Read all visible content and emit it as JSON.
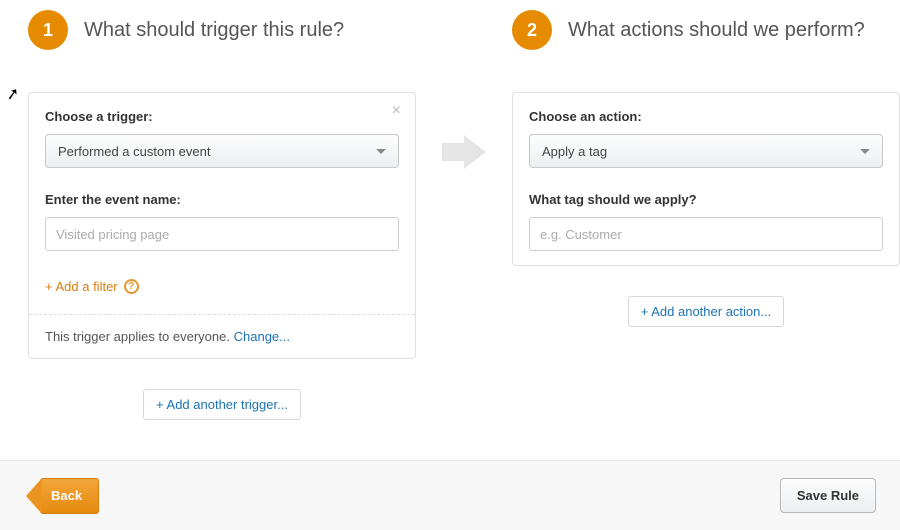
{
  "step1": {
    "number": "1",
    "title": "What should trigger this rule?",
    "card": {
      "trigger_label": "Choose a trigger:",
      "trigger_selected": "Performed a custom event",
      "event_name_label": "Enter the event name:",
      "event_name_placeholder": "Visited pricing page",
      "event_name_value": "",
      "add_filter_text": "+ Add a filter",
      "applies_text": "This trigger applies to everyone. ",
      "change_link": "Change..."
    },
    "add_another": "+ Add another trigger..."
  },
  "step2": {
    "number": "2",
    "title": "What actions should we perform?",
    "card": {
      "action_label": "Choose an action:",
      "action_selected": "Apply a tag",
      "tag_label": "What tag should we apply?",
      "tag_placeholder": "e.g. Customer",
      "tag_value": ""
    },
    "add_another": "+ Add another action..."
  },
  "footer": {
    "back": "Back",
    "save": "Save Rule"
  }
}
